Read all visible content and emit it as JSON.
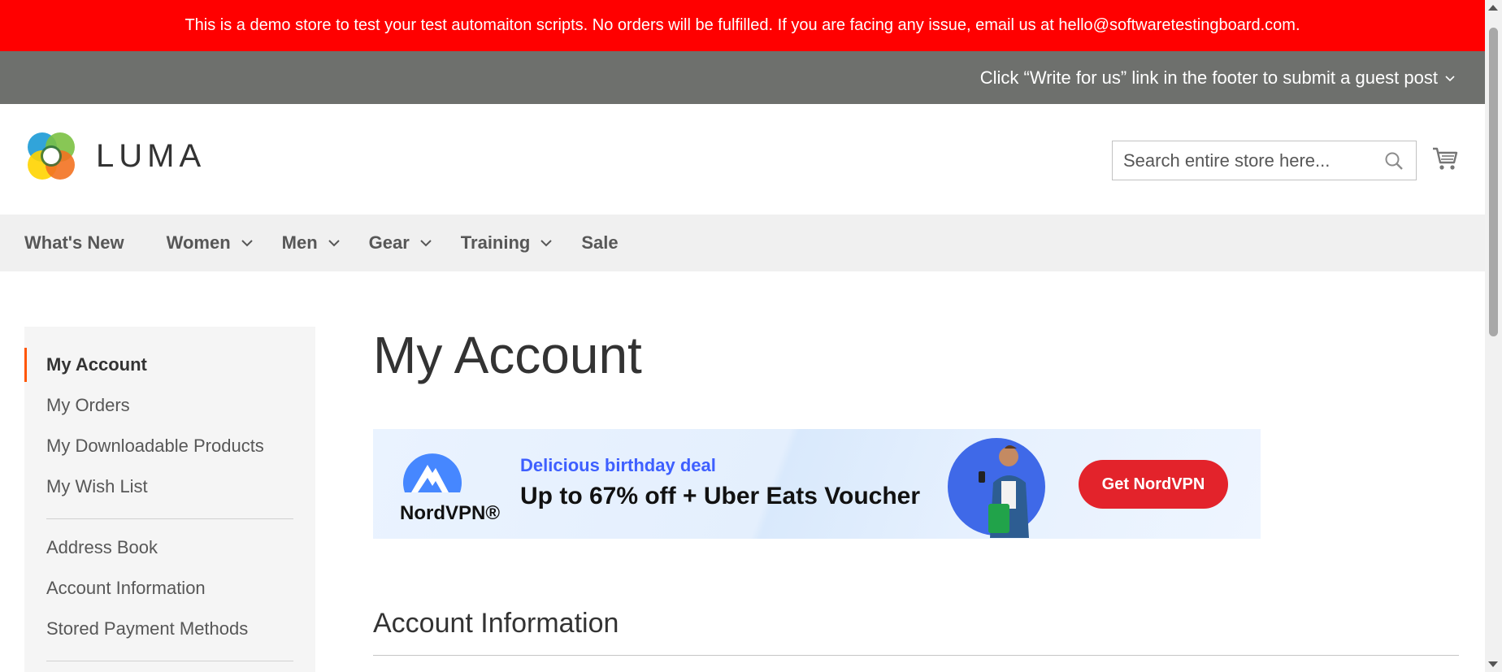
{
  "demo_notice": "This is a demo store to test your test automaiton scripts. No orders will be fulfilled. If you are facing any issue, email us at hello@softwaretestingboard.com.",
  "guest_post": "Click “Write for us” link in the footer to submit a guest post",
  "logo": {
    "text": "LUMA"
  },
  "search": {
    "placeholder": "Search entire store here..."
  },
  "nav": {
    "items": [
      {
        "label": "What's New"
      },
      {
        "label": "Women"
      },
      {
        "label": "Men"
      },
      {
        "label": "Gear"
      },
      {
        "label": "Training"
      },
      {
        "label": "Sale"
      }
    ]
  },
  "sidebar": {
    "items": [
      {
        "label": "My Account"
      },
      {
        "label": "My Orders"
      },
      {
        "label": "My Downloadable Products"
      },
      {
        "label": "My Wish List"
      },
      {
        "label": "Address Book"
      },
      {
        "label": "Account Information"
      },
      {
        "label": "Stored Payment Methods"
      }
    ]
  },
  "main": {
    "title": "My Account",
    "section_title": "Account Information"
  },
  "banner": {
    "brand": "NordVPN®",
    "sub": "Delicious birthday deal",
    "headline": "Up to 67% off + Uber Eats Voucher",
    "cta": "Get NordVPN"
  },
  "colors": {
    "demo_bar": "#ff0000",
    "guest_bar": "#6e706d",
    "nav_bg": "#f0f0f0",
    "active_accent": "#ff5501",
    "cta": "#e3232b"
  }
}
